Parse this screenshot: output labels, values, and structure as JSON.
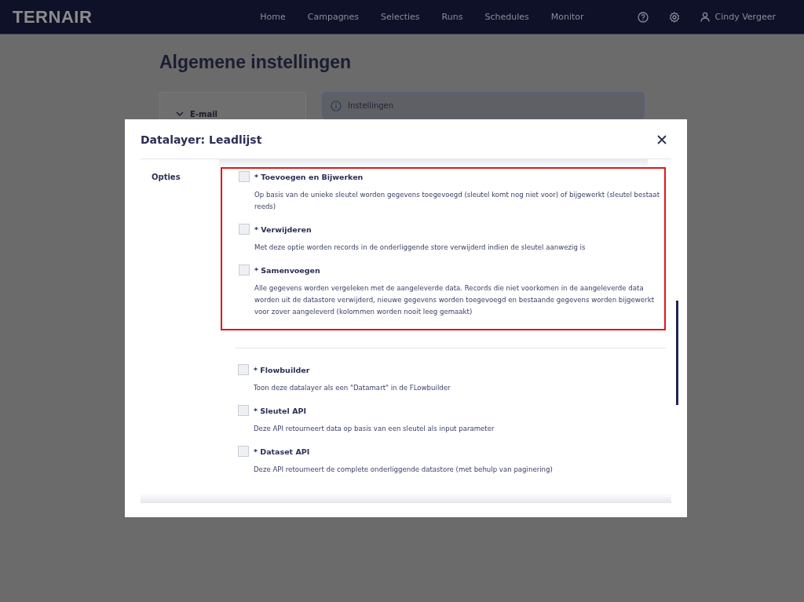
{
  "navbar": {
    "logo": "TERNAIR",
    "items": [
      "Home",
      "Campagnes",
      "Selecties",
      "Runs",
      "Schedules",
      "Monitor"
    ],
    "user": "Cindy Vergeer"
  },
  "page": {
    "title": "Algemene instellingen",
    "sidebar_item": "E-mail",
    "info": "Instellingen"
  },
  "modal": {
    "title": "Datalayer: Leadlijst",
    "field_label": "Opties",
    "groups": [
      {
        "highlighted": true,
        "options": [
          {
            "label": "* Toevoegen en Bijwerken",
            "checked": false,
            "description": "Op basis van de unieke sleutel worden gegevens toegevoegd (sleutel komt nog niet voor) of bijgewerkt (sleutel bestaat reeds)"
          },
          {
            "label": "* Verwijderen",
            "checked": false,
            "description": "Met deze optie worden records in de onderliggende store verwijderd indien de sleutel aanwezig is"
          },
          {
            "label": "* Samenvoegen",
            "checked": false,
            "description": "Alle gegevens worden vergeleken met de aangeleverde data. Records die niet voorkomen in de aangeleverde data worden uit de datastore verwijderd, nieuwe gegevens worden toegevoegd en bestaande gegevens worden bijgewerkt voor zover aangeleverd (kolommen worden nooit leeg gemaakt)"
          }
        ]
      },
      {
        "highlighted": false,
        "options": [
          {
            "label": "* Flowbuilder",
            "checked": false,
            "description": "Toon deze datalayer als een \"Datamart\" in de FLowbuilder"
          },
          {
            "label": "* Sleutel API",
            "checked": false,
            "description": "Deze API retourneert data op basis van een sleutel als input parameter"
          },
          {
            "label": "* Dataset API",
            "checked": false,
            "description": "Deze API retourneert de complete onderliggende datastore (met behulp van paginering)"
          }
        ]
      }
    ]
  }
}
